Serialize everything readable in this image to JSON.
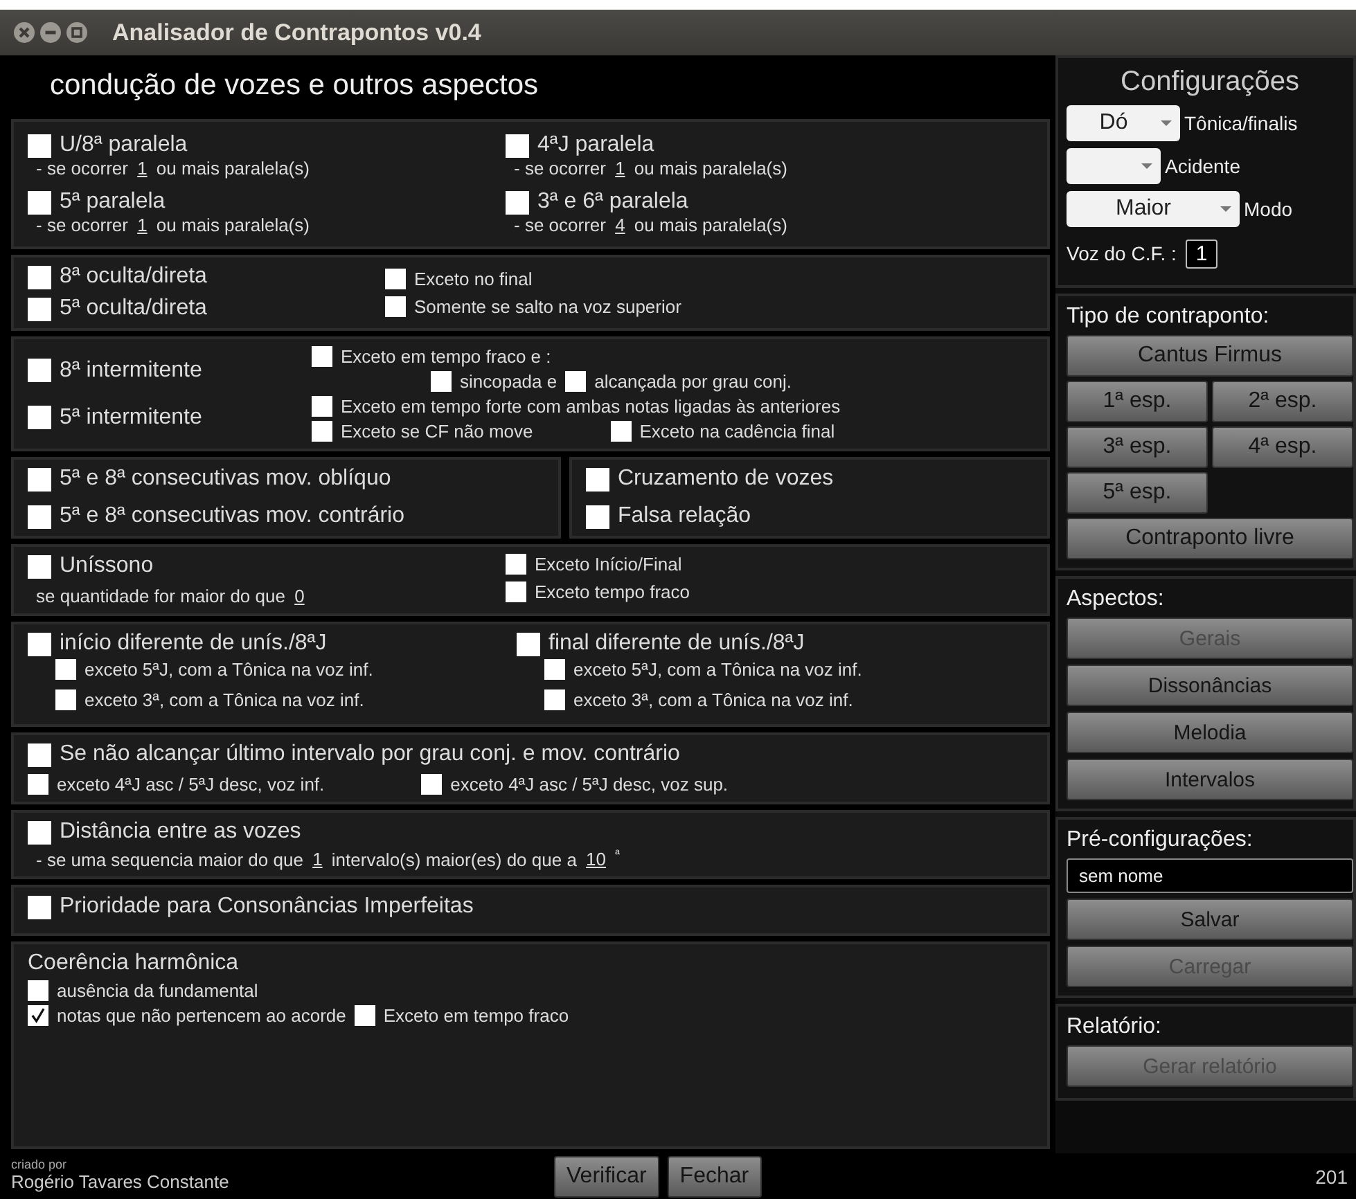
{
  "window": {
    "title": "Analisador de Contrapontos v0.4"
  },
  "main": {
    "heading": "condução de vozes e outros aspectos",
    "sections": [
      {
        "kind": "parallels",
        "items": [
          {
            "label": "U/8ª paralela",
            "checked": false,
            "rule": {
              "before": "- se ocorrer",
              "value": "1",
              "after": "ou mais paralela(s)"
            }
          },
          {
            "label": "4ªJ paralela",
            "checked": false,
            "rule": {
              "before": "- se ocorrer",
              "value": "1",
              "after": "ou mais paralela(s)"
            }
          },
          {
            "label": "5ª paralela",
            "checked": false,
            "rule": {
              "before": "- se ocorrer",
              "value": "1",
              "after": "ou mais paralela(s)"
            }
          },
          {
            "label": "3ª e 6ª paralela",
            "checked": false,
            "rule": {
              "before": "- se ocorrer",
              "value": "4",
              "after": "ou mais paralela(s)"
            }
          }
        ]
      },
      {
        "kind": "pairs",
        "left": [
          {
            "label": "8ª oculta/direta",
            "checked": false
          },
          {
            "label": "5ª oculta/direta",
            "checked": false
          }
        ],
        "right": [
          {
            "label": "Exceto no final",
            "checked": false
          },
          {
            "label": "Somente se salto na voz superior",
            "checked": false
          }
        ]
      },
      {
        "kind": "intermittent",
        "left": [
          {
            "label": "8ª intermitente",
            "checked": false
          },
          {
            "label": "5ª intermitente",
            "checked": false
          }
        ],
        "lines": [
          [
            {
              "label": "Exceto em tempo fraco e :",
              "checked": false
            }
          ],
          [
            {
              "label": "sincopada e",
              "checked": false
            },
            {
              "label": "alcançada por grau conj.",
              "checked": false
            }
          ],
          [
            {
              "label": "Exceto em tempo forte com ambas notas ligadas às anteriores",
              "checked": false
            }
          ],
          [
            {
              "label": "Exceto se CF não move",
              "checked": false
            },
            {
              "label": "Exceto na cadência final",
              "checked": false
            }
          ]
        ]
      },
      {
        "kind": "split",
        "boxes": [
          [
            {
              "label": "5ª e 8ª consecutivas mov. oblíquo",
              "checked": false
            },
            {
              "label": "5ª e 8ª consecutivas mov. contrário",
              "checked": false
            }
          ],
          [
            {
              "label": "Cruzamento de vozes",
              "checked": false
            },
            {
              "label": "Falsa relação",
              "checked": false
            }
          ]
        ]
      },
      {
        "kind": "unison",
        "main": {
          "label": "Uníssono",
          "checked": false
        },
        "rule": {
          "before": "se quantidade for maior do que",
          "value": "0"
        },
        "right": [
          {
            "label": "Exceto Início/Final",
            "checked": false
          },
          {
            "label": "Exceto tempo fraco",
            "checked": false
          }
        ]
      },
      {
        "kind": "ends",
        "columns": [
          {
            "main": {
              "label": "início diferente de unís./8ªJ",
              "checked": false
            },
            "subs": [
              {
                "label": "exceto 5ªJ, com a Tônica na voz inf.",
                "checked": false
              },
              {
                "label": "exceto 3ª, com a Tônica na voz inf.",
                "checked": false
              }
            ]
          },
          {
            "main": {
              "label": "final diferente de unís./8ªJ",
              "checked": false
            },
            "subs": [
              {
                "label": "exceto 5ªJ, com a Tônica na voz inf.",
                "checked": false
              },
              {
                "label": "exceto 3ª, com a Tônica na voz inf.",
                "checked": false
              }
            ]
          }
        ]
      },
      {
        "kind": "approach",
        "main": {
          "label": "Se não alcançar último intervalo por grau conj. e mov. contrário",
          "checked": false
        },
        "subs": [
          {
            "label": "exceto 4ªJ asc / 5ªJ desc, voz inf.",
            "checked": false
          },
          {
            "label": "exceto 4ªJ asc / 5ªJ desc, voz sup.",
            "checked": false
          }
        ]
      },
      {
        "kind": "distance",
        "main": {
          "label": "Distância entre as vozes",
          "checked": false
        },
        "rule": {
          "before": "- se uma sequencia maior do que",
          "value": "1",
          "middle": "intervalo(s) maior(es) do que a",
          "value2": "10",
          "after": "ª"
        }
      },
      {
        "kind": "single",
        "main": {
          "label": "Prioridade para Consonâncias Imperfeitas",
          "checked": false
        }
      },
      {
        "kind": "coherence",
        "title": "Coerência harmônica",
        "lines": [
          [
            {
              "label": "ausência da fundamental",
              "checked": false
            }
          ],
          [
            {
              "label": "notas que não pertencem ao acorde",
              "checked": true
            },
            {
              "label": "Exceto em tempo fraco",
              "checked": false
            }
          ]
        ]
      }
    ]
  },
  "config": {
    "title": "Configurações",
    "selects": [
      {
        "selected_option": "Dó",
        "caption": "Tônica/finalis"
      },
      {
        "caption": "Acidente"
      },
      {
        "selected_option": "Maior",
        "caption": "Modo"
      }
    ],
    "voice": {
      "label": "Voz do C.F. :",
      "value": "1"
    }
  },
  "counterpoint": {
    "title": "Tipo de contraponto:",
    "buttons": [
      {
        "label": "Cantus Firmus"
      },
      {
        "label": "1ª esp."
      },
      {
        "label": "2ª esp."
      },
      {
        "label": "3ª esp."
      },
      {
        "label": "4ª esp."
      },
      {
        "label": "5ª esp."
      },
      {
        "label": "Contraponto livre"
      }
    ]
  },
  "aspects": {
    "title": "Aspectos:",
    "buttons": [
      {
        "label": "Gerais",
        "disabled": true
      },
      {
        "label": "Dissonâncias",
        "disabled": false
      },
      {
        "label": "Melodia",
        "disabled": false
      },
      {
        "label": "Intervalos",
        "disabled": false
      }
    ]
  },
  "presets": {
    "title": "Pré-configurações:",
    "name": "sem nome",
    "buttons": [
      {
        "label": "Salvar",
        "disabled": false
      },
      {
        "label": "Carregar",
        "disabled": true
      }
    ]
  },
  "report": {
    "title": "Relatório:",
    "buttons": [
      {
        "label": "Gerar relatório",
        "disabled": true
      }
    ]
  },
  "footer": {
    "credit_label": "criado por",
    "author": "Rogério Tavares Constante",
    "buttons": [
      "Verificar",
      "Fechar"
    ],
    "year": "201"
  }
}
